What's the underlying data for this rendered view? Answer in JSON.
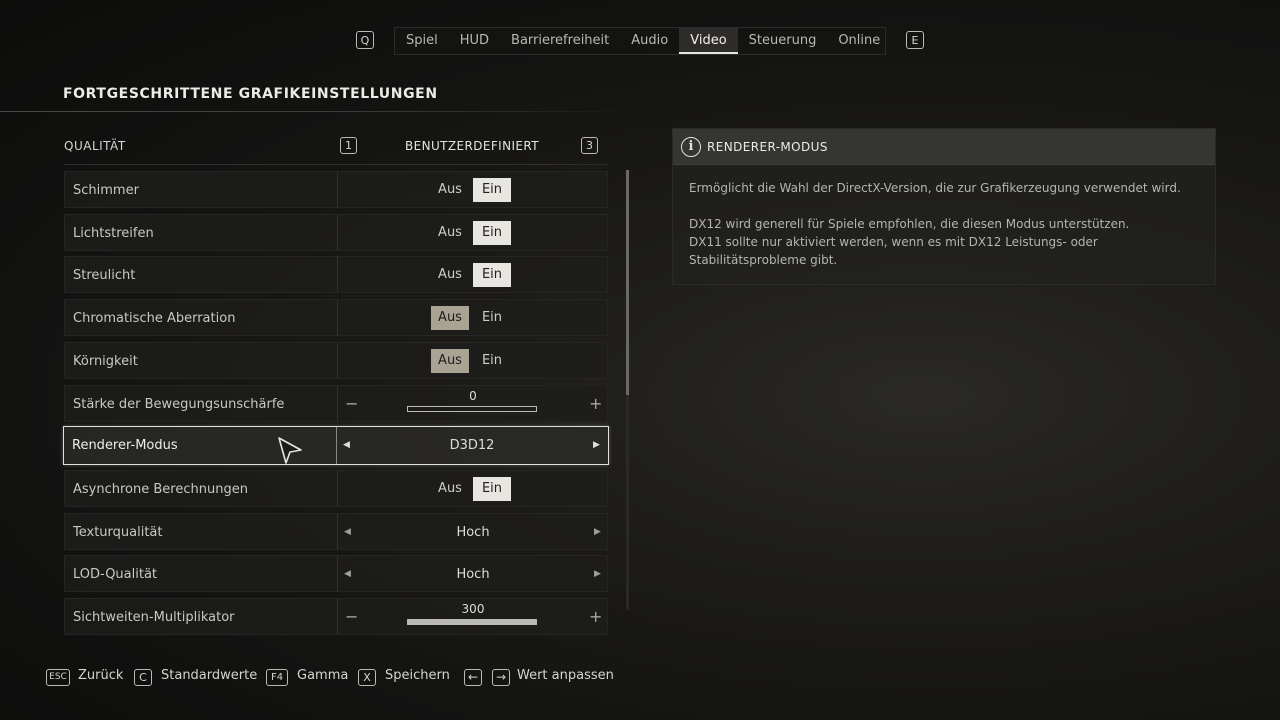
{
  "tabs": {
    "left_key": "Q",
    "right_key": "E",
    "items": [
      {
        "label": "Spiel",
        "active": false
      },
      {
        "label": "HUD",
        "active": false
      },
      {
        "label": "Barrierefreiheit",
        "active": false
      },
      {
        "label": "Audio",
        "active": false
      },
      {
        "label": "Video",
        "active": true
      },
      {
        "label": "Steuerung",
        "active": false
      },
      {
        "label": "Online",
        "active": false
      }
    ]
  },
  "page_title": "FORTGESCHRITTENE GRAFIKEINSTELLUNGEN",
  "quality": {
    "label": "QUALITÄT",
    "left_key": "1",
    "value": "BENUTZERDEFINIERT",
    "right_key": "3"
  },
  "settings": {
    "off_label": "Aus",
    "on_label": "Ein",
    "rows": [
      {
        "label": "Schimmer",
        "type": "toggle",
        "value": "Ein"
      },
      {
        "label": "Lichtstreifen",
        "type": "toggle",
        "value": "Ein"
      },
      {
        "label": "Streulicht",
        "type": "toggle",
        "value": "Ein"
      },
      {
        "label": "Chromatische Aberration",
        "type": "toggle",
        "value": "Aus"
      },
      {
        "label": "Körnigkeit",
        "type": "toggle",
        "value": "Aus"
      },
      {
        "label": "Stärke der Bewegungsunschärfe",
        "type": "slider",
        "value": "0",
        "fill_fraction": 0.0
      },
      {
        "label": "Renderer-Modus",
        "type": "selector",
        "value": "D3D12",
        "selected": true
      },
      {
        "label": "Asynchrone Berechnungen",
        "type": "toggle",
        "value": "Ein"
      },
      {
        "label": "Texturqualität",
        "type": "selector",
        "value": "Hoch"
      },
      {
        "label": "LOD-Qualität",
        "type": "selector",
        "value": "Hoch"
      },
      {
        "label": "Sichtweiten-Multiplikator",
        "type": "slider",
        "value": "300",
        "fill_fraction": 1.0
      }
    ]
  },
  "info": {
    "title": "RENDERER-MODUS",
    "line1": "Ermöglicht die Wahl der DirectX-Version, die zur Grafikerzeugung verwendet wird.",
    "line2": "DX12 wird generell für Spiele empfohlen, die diesen Modus unterstützen.",
    "line3": "DX11 sollte nur aktiviert werden, wenn es mit DX12 Leistungs- oder",
    "line4": "Stabilitätsprobleme gibt."
  },
  "footer": {
    "back_key": "ESC",
    "back_label": "Zurück",
    "defaults_key": "C",
    "defaults_label": "Standardwerte",
    "gamma_key": "F4",
    "gamma_label": "Gamma",
    "save_key": "X",
    "save_label": "Speichern",
    "adjust_label": "Wert anpassen"
  },
  "icons": {
    "info": "info-circle-icon",
    "cursor": "mouse-pointer-icon",
    "arrow_left_key": "arrow-left-key-icon",
    "arrow_right_key": "arrow-right-key-icon"
  },
  "colors": {
    "selected_toggle_light": "#e8e6e1",
    "selected_toggle_tan": "#a9a394",
    "text": "#cfcdc8"
  }
}
